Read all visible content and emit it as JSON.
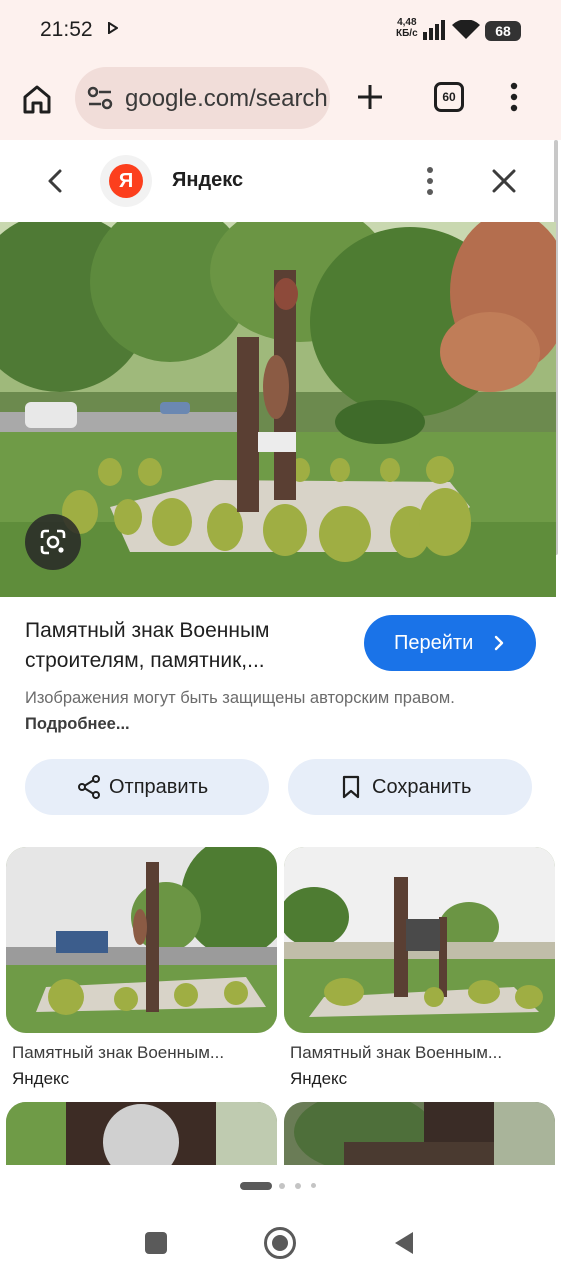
{
  "status_bar": {
    "time": "21:52",
    "speed_value": "4,48",
    "speed_unit": "КБ/с",
    "battery": "68"
  },
  "browser": {
    "url": "google.com/search",
    "tab_count": "60"
  },
  "panel": {
    "source_name": "Яндекс",
    "source_logo_letter": "Я",
    "title": "Памятный знак Военным строителям, памятник,...",
    "goto_label": "Перейти",
    "copyright_text": "Изображения могут быть защищены авторским правом.",
    "copyright_link": "Подробнее...",
    "share_label": "Отправить",
    "save_label": "Сохранить"
  },
  "related": [
    {
      "title": "Памятный знак Военным...",
      "source": "Яндекс"
    },
    {
      "title": "Памятный знак Военным...",
      "source": "Яндекс"
    }
  ],
  "colors": {
    "accent": "#1a73e8",
    "toolbar_bg": "#fdf1ee",
    "yandex_red": "#fc3f1d"
  }
}
